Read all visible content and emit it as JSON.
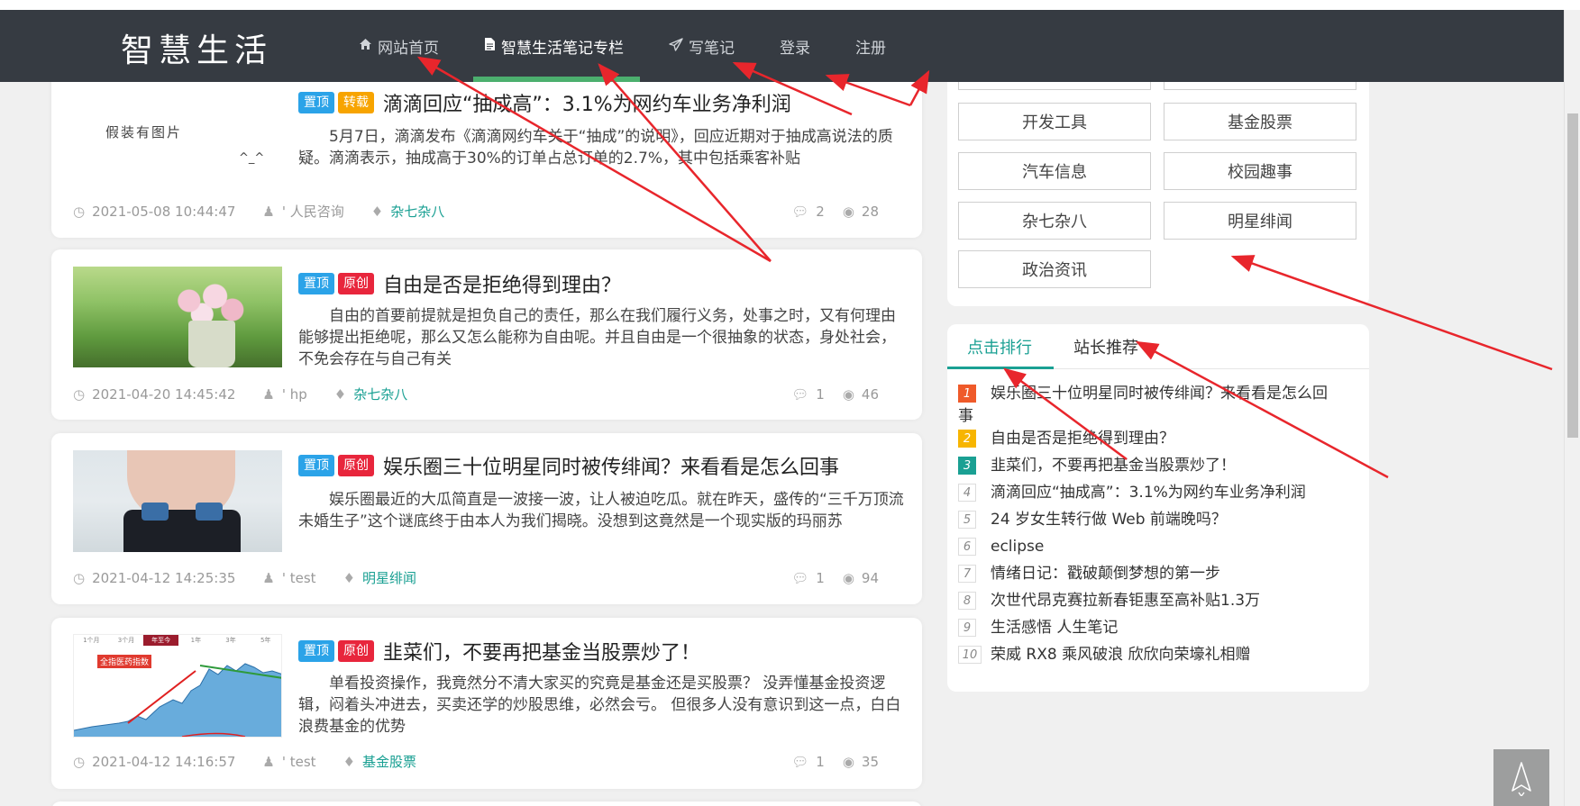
{
  "header": {
    "logo": "智慧生活",
    "nav": [
      {
        "label": "网站首页",
        "icon": "home-icon"
      },
      {
        "label": "智慧生活笔记专栏",
        "icon": "document-icon"
      },
      {
        "label": "写笔记",
        "icon": "paper-plane-icon"
      },
      {
        "label": "登录"
      },
      {
        "label": "注册"
      }
    ],
    "active_index": 1
  },
  "posts": [
    {
      "badges": [
        "置顶",
        "转载"
      ],
      "title": "滴滴回应“抽成高”：3.1%为网约车业务净利润",
      "thumb_text": "假装有图片",
      "thumb_sub": "^_^",
      "excerpt": "5月7日，滴滴发布《滴滴网约车关于“抽成”的说明》，回应近期对于抽成高说法的质疑。滴滴表示，抽成高于30%的订单占总订单的2.7%，其中包括乘客补贴",
      "date": "2021-05-08 10:44:47",
      "author": "' 人民咨询",
      "tag": "杂七杂八",
      "comments": "2",
      "views": "28"
    },
    {
      "badges": [
        "置顶",
        "原创"
      ],
      "title": "自由是否是拒绝得到理由？",
      "excerpt": "自由的首要前提就是担负自己的责任，那么在我们履行义务，处事之时，又有何理由能够提出拒绝呢，那么又怎么能称为自由呢。并且自由是一个很抽象的状态，身处社会，不免会存在与自己有关",
      "date": "2021-04-20 14:45:42",
      "author": "' hp",
      "tag": "杂七杂八",
      "comments": "1",
      "views": "46"
    },
    {
      "badges": [
        "置顶",
        "原创"
      ],
      "title": "娱乐圈三十位明星同时被传绯闻？来看看是怎么回事",
      "excerpt": "娱乐圈最近的大瓜简直是一波接一波，让人被迫吃瓜。就在昨天，盛传的“三千万顶流未婚生子”这个谜底终于由本人为我们揭晓。没想到这竟然是一个现实版的玛丽苏",
      "date": "2021-04-12 14:25:35",
      "author": "' test",
      "tag": "明星绯闻",
      "comments": "1",
      "views": "94"
    },
    {
      "badges": [
        "置顶",
        "原创"
      ],
      "title": "韭菜们，不要再把基金当股票炒了！",
      "excerpt": "单看投资操作，我竟然分不清大家买的究竟是基金还是买股票？ 没弄懂基金投资逻辑，闷着头冲进去，买卖还学的炒股思维，必然会亏。 但很多人没有意识到这一点，白白浪费基金的优势",
      "chart_label": "全指医药指数",
      "chart_tabs": [
        "1个月",
        "3个月",
        "年至今",
        "1年",
        "3年",
        "5年"
      ],
      "date": "2021-04-12 14:16:57",
      "author": "' test",
      "tag": "基金股票",
      "comments": "1",
      "views": "35"
    }
  ],
  "categories": [
    "开发工具",
    "基金股票",
    "汽车信息",
    "校园趣事",
    "杂七杂八",
    "明星绯闻",
    "政治资讯"
  ],
  "ranking": {
    "tabs": [
      "点击排行",
      "站长推荐"
    ],
    "active_tab": 0,
    "items": [
      {
        "num": "1",
        "title": "娱乐圈三十位明星同时被传绯闻？来看看是怎么回",
        "title_cont": "事"
      },
      {
        "num": "2",
        "title": "自由是否是拒绝得到理由？"
      },
      {
        "num": "3",
        "title": "韭菜们，不要再把基金当股票炒了！"
      },
      {
        "num": "4",
        "title": "滴滴回应“抽成高”：3.1%为网约车业务净利润"
      },
      {
        "num": "5",
        "title": "24 岁女生转行做 Web 前端晚吗？"
      },
      {
        "num": "6",
        "title": "eclipse"
      },
      {
        "num": "7",
        "title": "情绪日记：戳破颠倒梦想的第一步"
      },
      {
        "num": "8",
        "title": "次世代昂克赛拉新春钜惠至高补贴1.3万"
      },
      {
        "num": "9",
        "title": " 生活感悟 人生笔记"
      },
      {
        "num": "10",
        "title": " 荣威 RX8 乘风破浪 欣欣向荣壕礼相赠"
      }
    ]
  },
  "colors": {
    "header_bg": "#363b42",
    "accent": "#1aa093",
    "nav_underline": "#4caf6e",
    "annotation_arrows": "#e8262c"
  }
}
